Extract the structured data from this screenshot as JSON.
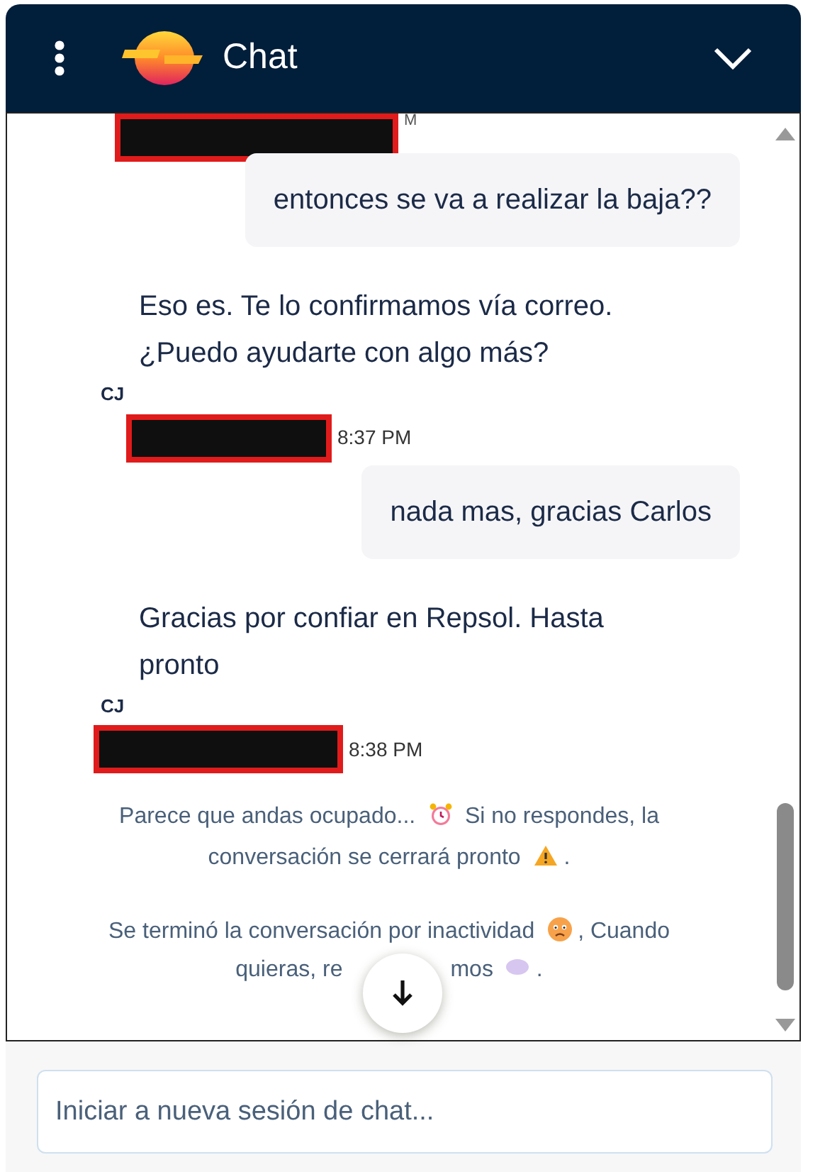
{
  "header": {
    "title": "Chat"
  },
  "messages": [
    {
      "kind": "user",
      "text": "entonces se va a realizar la baja??",
      "cut_time": "M"
    },
    {
      "kind": "agent",
      "lines": [
        "Eso es. Te lo confirmamos vía correo.",
        "¿Puedo ayudarte con algo más?"
      ],
      "initials": "CJ",
      "time": "8:37 PM"
    },
    {
      "kind": "user",
      "text": "nada mas, gracias Carlos"
    },
    {
      "kind": "agent",
      "lines": [
        "Gracias por confiar en Repsol. Hasta",
        "pronto"
      ],
      "initials": "CJ",
      "time": "8:38 PM"
    },
    {
      "kind": "notice",
      "parts": [
        "Parece que andas ocupado...",
        "Si no respondes, la conversación se cerrará pronto",
        "."
      ]
    },
    {
      "kind": "notice_covered",
      "parts": [
        "Se terminó la conversación por inactividad",
        ", Cuando",
        "quieras, re",
        "mos",
        "."
      ]
    }
  ],
  "input": {
    "placeholder": "Iniciar a nueva sesión de chat..."
  }
}
